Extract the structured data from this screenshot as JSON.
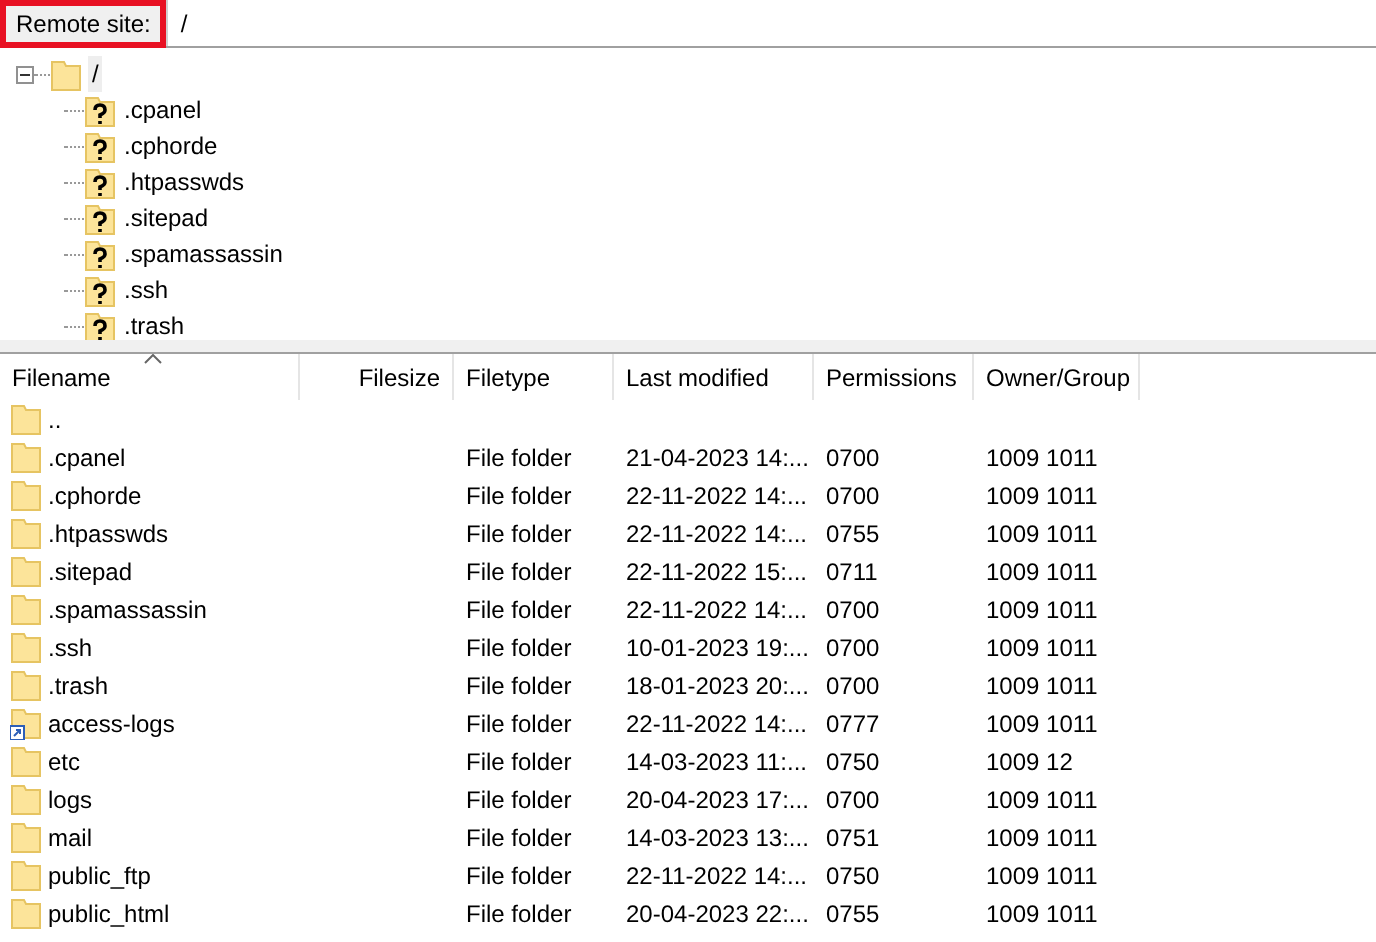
{
  "path_bar": {
    "label": "Remote site:",
    "highlighted": true,
    "value": "/"
  },
  "tree": {
    "label": "/",
    "expanded": true,
    "selected": true,
    "children": [
      {
        "label": ".cpanel",
        "kind": "unknown",
        "selected": false
      },
      {
        "label": ".cphorde",
        "kind": "unknown",
        "selected": false
      },
      {
        "label": ".htpasswds",
        "kind": "unknown",
        "selected": false
      },
      {
        "label": ".sitepad",
        "kind": "unknown",
        "selected": false
      },
      {
        "label": ".spamassassin",
        "kind": "unknown",
        "selected": false
      },
      {
        "label": ".ssh",
        "kind": "unknown",
        "selected": false
      },
      {
        "label": ".trash",
        "kind": "unknown",
        "selected": false
      }
    ]
  },
  "table": {
    "columns": [
      {
        "label": "Filename",
        "sorted": true
      },
      {
        "label": "Filesize",
        "sorted": false
      },
      {
        "label": "Filetype",
        "sorted": false
      },
      {
        "label": "Last modified",
        "sorted": false
      },
      {
        "label": "Permissions",
        "sorted": false
      },
      {
        "label": "Owner/Group",
        "sorted": false
      }
    ],
    "rows": [
      {
        "kind": "folder",
        "cells": [
          "..",
          "",
          "",
          "",
          "",
          ""
        ]
      },
      {
        "kind": "folder",
        "cells": [
          ".cpanel",
          "",
          "File folder",
          "21-04-2023 14:...",
          "0700",
          "1009 1011"
        ]
      },
      {
        "kind": "folder",
        "cells": [
          ".cphorde",
          "",
          "File folder",
          "22-11-2022 14:...",
          "0700",
          "1009 1011"
        ]
      },
      {
        "kind": "folder",
        "cells": [
          ".htpasswds",
          "",
          "File folder",
          "22-11-2022 14:...",
          "0755",
          "1009 1011"
        ]
      },
      {
        "kind": "folder",
        "cells": [
          ".sitepad",
          "",
          "File folder",
          "22-11-2022 15:...",
          "0711",
          "1009 1011"
        ]
      },
      {
        "kind": "folder",
        "cells": [
          ".spamassassin",
          "",
          "File folder",
          "22-11-2022 14:...",
          "0700",
          "1009 1011"
        ]
      },
      {
        "kind": "folder",
        "cells": [
          ".ssh",
          "",
          "File folder",
          "10-01-2023 19:...",
          "0700",
          "1009 1011"
        ]
      },
      {
        "kind": "folder",
        "cells": [
          ".trash",
          "",
          "File folder",
          "18-01-2023 20:...",
          "0700",
          "1009 1011"
        ]
      },
      {
        "kind": "link",
        "cells": [
          "access-logs",
          "",
          "File folder",
          "22-11-2022 14:...",
          "0777",
          "1009 1011"
        ]
      },
      {
        "kind": "folder",
        "cells": [
          "etc",
          "",
          "File folder",
          "14-03-2023 11:...",
          "0750",
          "1009 12"
        ]
      },
      {
        "kind": "folder",
        "cells": [
          "logs",
          "",
          "File folder",
          "20-04-2023 17:...",
          "0700",
          "1009 1011"
        ]
      },
      {
        "kind": "folder",
        "cells": [
          "mail",
          "",
          "File folder",
          "14-03-2023 13:...",
          "0751",
          "1009 1011"
        ]
      },
      {
        "kind": "folder",
        "cells": [
          "public_ftp",
          "",
          "File folder",
          "22-11-2022 14:...",
          "0750",
          "1009 1011"
        ]
      },
      {
        "kind": "folder",
        "cells": [
          "public_html",
          "",
          "File folder",
          "20-04-2023 22:...",
          "0755",
          "1009 1011"
        ]
      }
    ]
  }
}
